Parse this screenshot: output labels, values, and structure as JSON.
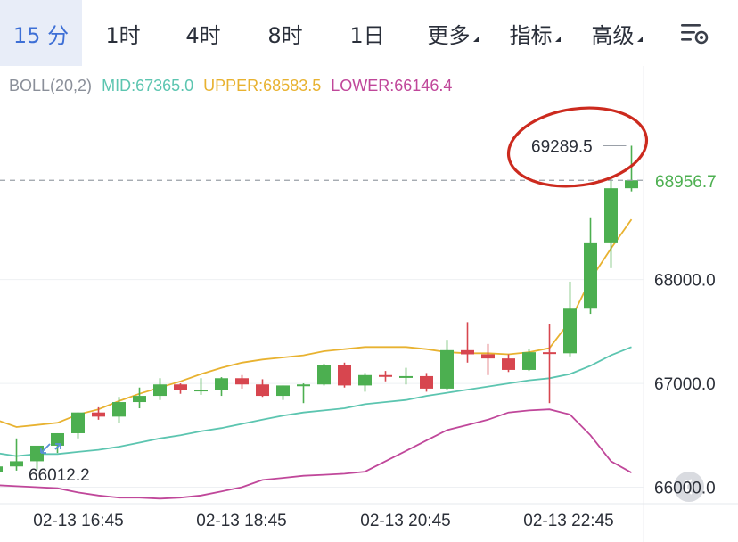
{
  "tabs": [
    {
      "label": "15 分",
      "active": true
    },
    {
      "label": "1时"
    },
    {
      "label": "4时"
    },
    {
      "label": "8时"
    },
    {
      "label": "1日"
    },
    {
      "label": "更多",
      "dropdown": true
    },
    {
      "label": "指标",
      "dropdown": true
    },
    {
      "label": "高级",
      "dropdown": true
    }
  ],
  "settings_icon": "chart-settings-icon",
  "indicator": {
    "name": "BOLL(20,2)",
    "mid": "MID:67365.0",
    "upper": "UPPER:68583.5",
    "lower": "LOWER:66146.4"
  },
  "colors": {
    "up": "#4caf50",
    "down": "#d7464f",
    "mid": "#5cc5b0",
    "upper": "#e8b230",
    "lower": "#c0479a",
    "active_tab": "#3d6fd6",
    "annotation_circle": "#cc2a1e"
  },
  "price_tag": "68956.7",
  "high_label": "69289.5",
  "low_label": "66012.2",
  "chart_data": {
    "type": "candlestick",
    "x_ticks": [
      "02-13 16:45",
      "02-13 18:45",
      "02-13 20:45",
      "02-13 22:45"
    ],
    "y_ticks": [
      "68000.0",
      "67000.0",
      "66000.0"
    ],
    "ylim": [
      65850,
      69680
    ],
    "current_price": 68956.7,
    "candles": [
      {
        "o": 66150,
        "h": 66230,
        "l": 66080,
        "c": 66200
      },
      {
        "o": 66200,
        "h": 66470,
        "l": 66160,
        "c": 66250
      },
      {
        "o": 66250,
        "h": 66360,
        "l": 66170,
        "c": 66400
      },
      {
        "o": 66400,
        "h": 66520,
        "l": 66330,
        "c": 66520
      },
      {
        "o": 66520,
        "h": 66720,
        "l": 66470,
        "c": 66720
      },
      {
        "o": 66720,
        "h": 66770,
        "l": 66650,
        "c": 66680
      },
      {
        "o": 66680,
        "h": 66870,
        "l": 66620,
        "c": 66820
      },
      {
        "o": 66820,
        "h": 66960,
        "l": 66760,
        "c": 66880
      },
      {
        "o": 66880,
        "h": 67050,
        "l": 66840,
        "c": 66990
      },
      {
        "o": 66990,
        "h": 67000,
        "l": 66900,
        "c": 66940
      },
      {
        "o": 66940,
        "h": 67050,
        "l": 66890,
        "c": 66940
      },
      {
        "o": 66940,
        "h": 67060,
        "l": 66880,
        "c": 67050
      },
      {
        "o": 67050,
        "h": 67080,
        "l": 66950,
        "c": 66990
      },
      {
        "o": 66990,
        "h": 67040,
        "l": 66870,
        "c": 66880
      },
      {
        "o": 66880,
        "h": 66980,
        "l": 66840,
        "c": 66980
      },
      {
        "o": 66980,
        "h": 67000,
        "l": 66810,
        "c": 66990
      },
      {
        "o": 66990,
        "h": 67190,
        "l": 66980,
        "c": 67180
      },
      {
        "o": 67180,
        "h": 67200,
        "l": 66960,
        "c": 66980
      },
      {
        "o": 66980,
        "h": 67100,
        "l": 66920,
        "c": 67080
      },
      {
        "o": 67080,
        "h": 67120,
        "l": 67020,
        "c": 67070
      },
      {
        "o": 67070,
        "h": 67150,
        "l": 66990,
        "c": 67070
      },
      {
        "o": 67070,
        "h": 67100,
        "l": 66920,
        "c": 66950
      },
      {
        "o": 66950,
        "h": 67420,
        "l": 66940,
        "c": 67320
      },
      {
        "o": 67320,
        "h": 67590,
        "l": 67200,
        "c": 67280
      },
      {
        "o": 67280,
        "h": 67380,
        "l": 67080,
        "c": 67240
      },
      {
        "o": 67240,
        "h": 67280,
        "l": 67110,
        "c": 67130
      },
      {
        "o": 67130,
        "h": 67330,
        "l": 67120,
        "c": 67300
      },
      {
        "o": 67300,
        "h": 67570,
        "l": 66810,
        "c": 67290
      },
      {
        "o": 67290,
        "h": 67980,
        "l": 67260,
        "c": 67720
      },
      {
        "o": 67720,
        "h": 68600,
        "l": 67670,
        "c": 68350
      },
      {
        "o": 68350,
        "h": 68980,
        "l": 68110,
        "c": 68880
      },
      {
        "o": 68880,
        "h": 69289.5,
        "l": 68850,
        "c": 68956.7
      }
    ],
    "boll_mid": [
      66330,
      66300,
      66320,
      66320,
      66340,
      66360,
      66390,
      66430,
      66470,
      66500,
      66540,
      66570,
      66610,
      66650,
      66690,
      66720,
      66740,
      66760,
      66800,
      66820,
      66840,
      66880,
      66910,
      66940,
      66970,
      67000,
      67030,
      67050,
      67090,
      67170,
      67270,
      67350
    ],
    "boll_upper": [
      66650,
      66580,
      66600,
      66620,
      66700,
      66750,
      66830,
      66900,
      66960,
      67020,
      67090,
      67150,
      67200,
      67230,
      67250,
      67270,
      67310,
      67330,
      67350,
      67350,
      67350,
      67330,
      67300,
      67290,
      67290,
      67280,
      67300,
      67340,
      67600,
      68000,
      68300,
      68580
    ],
    "boll_lower": [
      66020,
      66010,
      66000,
      65990,
      65950,
      65920,
      65900,
      65900,
      65890,
      65900,
      65920,
      65960,
      66000,
      66070,
      66090,
      66110,
      66120,
      66130,
      66150,
      66250,
      66350,
      66450,
      66550,
      66600,
      66650,
      66720,
      66740,
      66750,
      66700,
      66500,
      66250,
      66140
    ]
  }
}
